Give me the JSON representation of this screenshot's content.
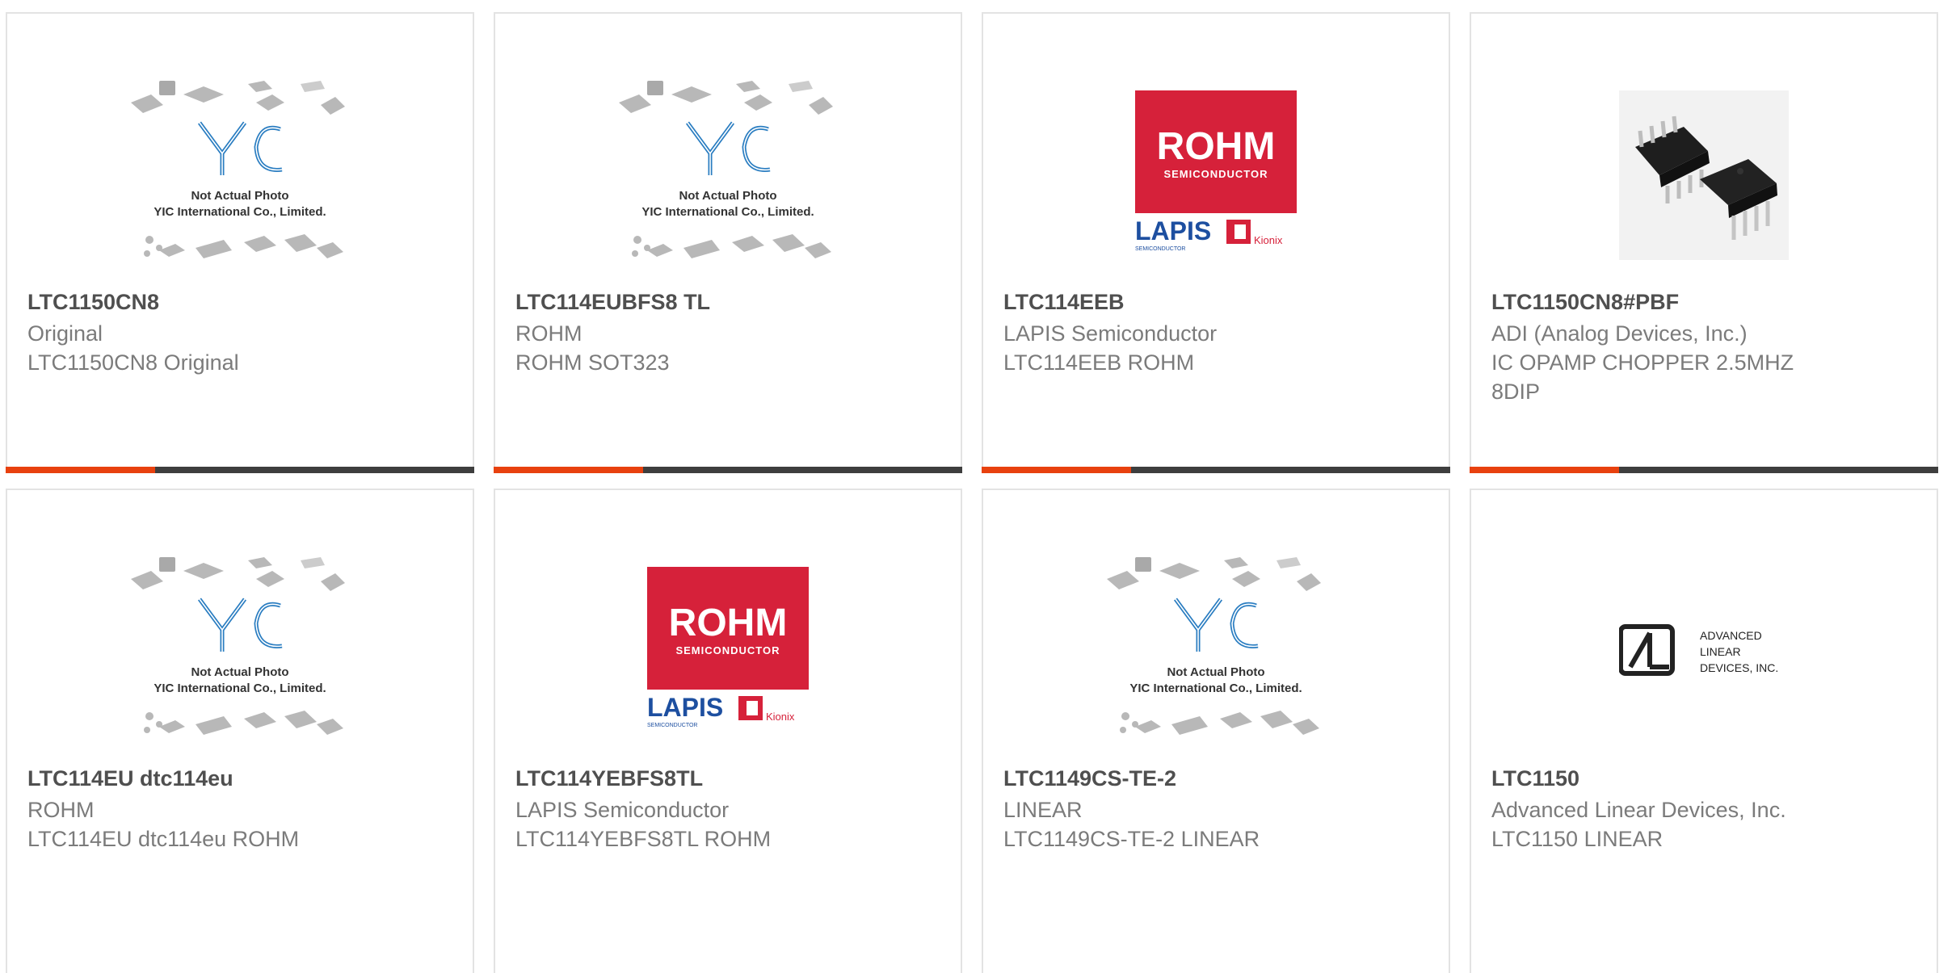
{
  "colors": {
    "accent": "#e8410f",
    "bar_dark": "#3e3e3e",
    "rohm_red": "#d6213a",
    "lapis_blue": "#1d4fa0"
  },
  "placeholder": {
    "brand": "YIC",
    "line1": "Not Actual Photo",
    "line2": "YIC International Co., Limited."
  },
  "rohm_logo": {
    "word": "ROHM",
    "sub": "SEMICONDUCTOR",
    "lapis": "LAPIS",
    "lapis_sub": "SEMICONDUCTOR",
    "kionix": "Kionix"
  },
  "ald_logo": {
    "line1": "ADVANCED",
    "line2": "LINEAR",
    "line3": "DEVICES, INC."
  },
  "products": [
    {
      "part": "LTC1150CN8",
      "manufacturer": "Original",
      "description": "LTC1150CN8 Original",
      "image": "placeholder-photo"
    },
    {
      "part": "LTC114EUBFS8 TL",
      "manufacturer": "ROHM",
      "description": "ROHM SOT323",
      "image": "placeholder-photo"
    },
    {
      "part": "LTC114EEB",
      "manufacturer": "LAPIS Semiconductor",
      "description": "LTC114EEB ROHM",
      "image": "rohm-logo"
    },
    {
      "part": "LTC1150CN8#PBF",
      "manufacturer": "ADI (Analog Devices, Inc.)",
      "description": "IC OPAMP CHOPPER 2.5MHZ 8DIP",
      "image": "dip8-chip-photo"
    },
    {
      "part": "LTC114EU dtc114eu",
      "manufacturer": "ROHM",
      "description": "LTC114EU dtc114eu ROHM",
      "image": "placeholder-photo"
    },
    {
      "part": "LTC114YEBFS8TL",
      "manufacturer": "LAPIS Semiconductor",
      "description": "LTC114YEBFS8TL ROHM",
      "image": "rohm-logo"
    },
    {
      "part": "LTC1149CS-TE-2",
      "manufacturer": "LINEAR",
      "description": "LTC1149CS-TE-2 LINEAR",
      "image": "placeholder-photo"
    },
    {
      "part": "LTC1150",
      "manufacturer": "Advanced Linear Devices, Inc.",
      "description": "LTC1150 LINEAR",
      "image": "ald-logo"
    }
  ]
}
